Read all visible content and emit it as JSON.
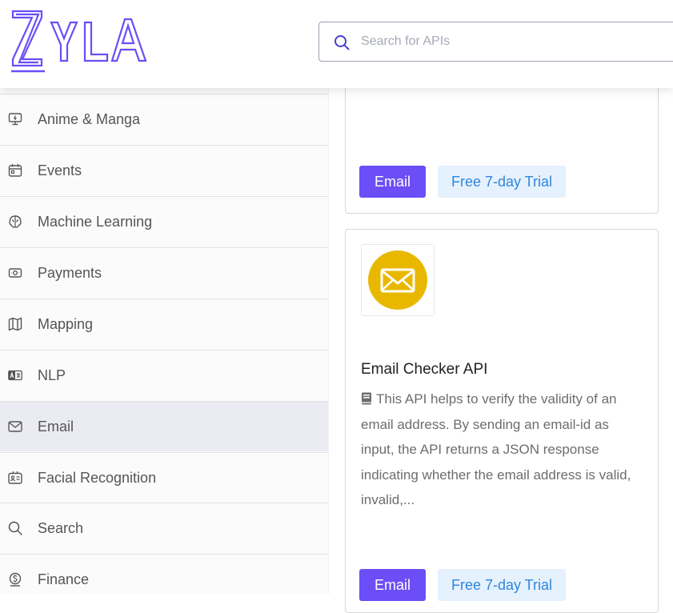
{
  "brand": {
    "logo_text": "ZYLA",
    "accent": "#6b4ef6"
  },
  "search": {
    "placeholder": "Search for APIs",
    "value": ""
  },
  "sidebar": {
    "items": [
      {
        "label": "Anime & Manga",
        "icon": "monitor-icon",
        "active": false
      },
      {
        "label": "Events",
        "icon": "calendar-icon",
        "active": false
      },
      {
        "label": "Machine Learning",
        "icon": "brain-icon",
        "active": false
      },
      {
        "label": "Payments",
        "icon": "cash-icon",
        "active": false
      },
      {
        "label": "Mapping",
        "icon": "map-icon",
        "active": false
      },
      {
        "label": "NLP",
        "icon": "language-icon",
        "active": false
      },
      {
        "label": "Email",
        "icon": "mail-icon",
        "active": true
      },
      {
        "label": "Facial Recognition",
        "icon": "face-id-icon",
        "active": false
      },
      {
        "label": "Search",
        "icon": "search-icon",
        "active": false
      },
      {
        "label": "Finance",
        "icon": "coin-icon",
        "active": false
      }
    ]
  },
  "cards": [
    {
      "category_button": "Email",
      "trial_button": "Free 7-day Trial"
    },
    {
      "title": "Email Checker API",
      "description": "This API helps to verify the validity of an email address. By sending an email-id as input, the API returns a JSON response indicating whether the email address is valid, invalid,...",
      "logo_icon": "envelope-icon",
      "logo_color": "#e8b800",
      "category_button": "Email",
      "trial_button": "Free 7-day Trial"
    }
  ]
}
